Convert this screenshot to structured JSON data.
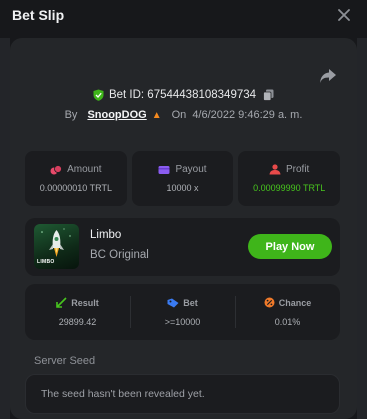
{
  "header": {
    "title": "Bet Slip"
  },
  "bet": {
    "id_label": "Bet ID: 67544438108349734",
    "by_label": "By",
    "username": "SnoopDOG",
    "on_label": "On",
    "datetime": "4/6/2022 9:46:29 a. m."
  },
  "stats": [
    {
      "label": "Amount",
      "value": "0.00000010 TRTL",
      "icon": "coins-icon",
      "color": "#e84a6a"
    },
    {
      "label": "Payout",
      "value": "10000 x",
      "icon": "wallet-icon",
      "color": "#8a5cf0"
    },
    {
      "label": "Profit",
      "value": "0.00099990 TRTL",
      "icon": "profit-icon",
      "color": "#e84a4a"
    }
  ],
  "game": {
    "name": "Limbo",
    "subtitle": "BC Original",
    "thumb_text": "LIMBO",
    "play_label": "Play Now"
  },
  "results": [
    {
      "label": "Result",
      "value": "29899.42",
      "icon": "result-icon",
      "color": "#48c51e"
    },
    {
      "label": "Bet",
      "value": ">=10000",
      "icon": "bet-tag-icon",
      "color": "#3a7bf2"
    },
    {
      "label": "Chance",
      "value": "0.01%",
      "icon": "percent-icon",
      "color": "#f07a2a"
    }
  ],
  "seed": {
    "label": "Server Seed",
    "text": "The seed hasn't been revealed yet."
  },
  "colors": {
    "accent_green": "#3fb51a",
    "profit_green": "#48c51e"
  }
}
